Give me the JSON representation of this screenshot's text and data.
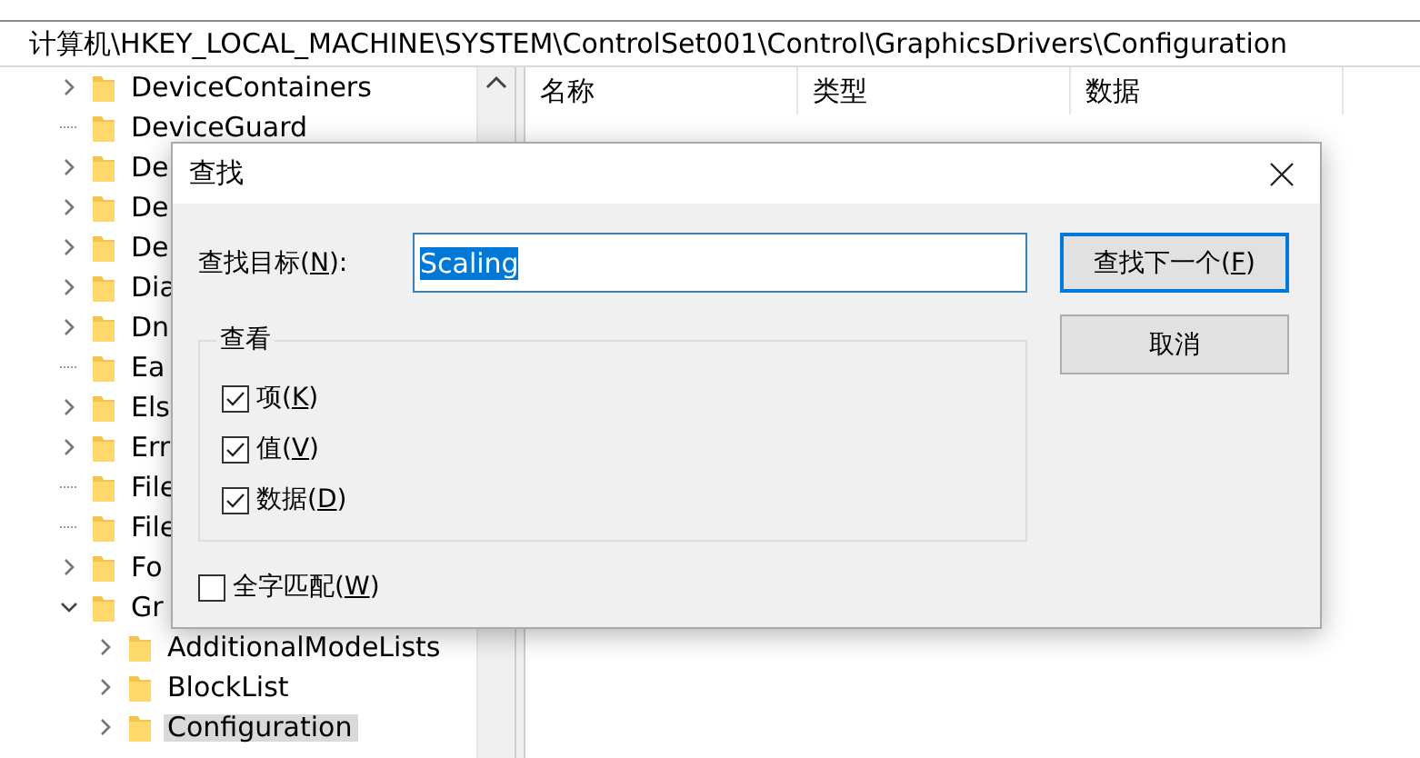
{
  "address_bar": {
    "path": "计算机\\HKEY_LOCAL_MACHINE\\SYSTEM\\ControlSet001\\Control\\GraphicsDrivers\\Configuration"
  },
  "tree": {
    "items": [
      {
        "label": "DeviceContainers",
        "kind": "branch",
        "expanded": false,
        "selected": false
      },
      {
        "label": "DeviceGuard",
        "kind": "leaf",
        "selected": false
      },
      {
        "label": "De",
        "kind": "branch",
        "expanded": false,
        "selected": false
      },
      {
        "label": "De",
        "kind": "branch",
        "expanded": false,
        "selected": false
      },
      {
        "label": "De",
        "kind": "branch",
        "expanded": false,
        "selected": false
      },
      {
        "label": "Dia",
        "kind": "branch",
        "expanded": false,
        "selected": false
      },
      {
        "label": "Dn",
        "kind": "branch",
        "expanded": false,
        "selected": false
      },
      {
        "label": "Ea",
        "kind": "leaf",
        "selected": false
      },
      {
        "label": "Els",
        "kind": "branch",
        "expanded": false,
        "selected": false
      },
      {
        "label": "Err",
        "kind": "branch",
        "expanded": false,
        "selected": false
      },
      {
        "label": "File",
        "kind": "leaf",
        "selected": false
      },
      {
        "label": "File",
        "kind": "leaf",
        "selected": false
      },
      {
        "label": "Fo",
        "kind": "branch",
        "expanded": false,
        "selected": false
      },
      {
        "label": "Gr",
        "kind": "branch",
        "expanded": true,
        "selected": false,
        "children": [
          {
            "label": "AdditionalModeLists",
            "kind": "branch",
            "expanded": false,
            "selected": false
          },
          {
            "label": "BlockList",
            "kind": "branch",
            "expanded": false,
            "selected": false
          },
          {
            "label": "Configuration",
            "kind": "branch",
            "expanded": false,
            "selected": true
          }
        ]
      }
    ]
  },
  "list": {
    "columns": [
      "名称",
      "类型",
      "数据"
    ]
  },
  "dialog": {
    "title": "查找",
    "find_field": {
      "label_before": "查找目标(",
      "access_key": "N",
      "label_after": "):",
      "value": "Scaling"
    },
    "look_at": {
      "title": "查看",
      "options": [
        {
          "label_before": "项(",
          "access_key": "K",
          "label_after": ")",
          "checked": true
        },
        {
          "label_before": "值(",
          "access_key": "V",
          "label_after": ")",
          "checked": true
        },
        {
          "label_before": "数据(",
          "access_key": "D",
          "label_after": ")",
          "checked": true
        }
      ]
    },
    "match_whole": {
      "label_before": "全字匹配(",
      "access_key": "W",
      "label_after": ")",
      "checked": false
    },
    "buttons": [
      {
        "label_before": "查找下一个(",
        "access_key": "F",
        "label_after": ")",
        "default": true
      },
      {
        "label_before": "取消",
        "default": false
      }
    ]
  }
}
